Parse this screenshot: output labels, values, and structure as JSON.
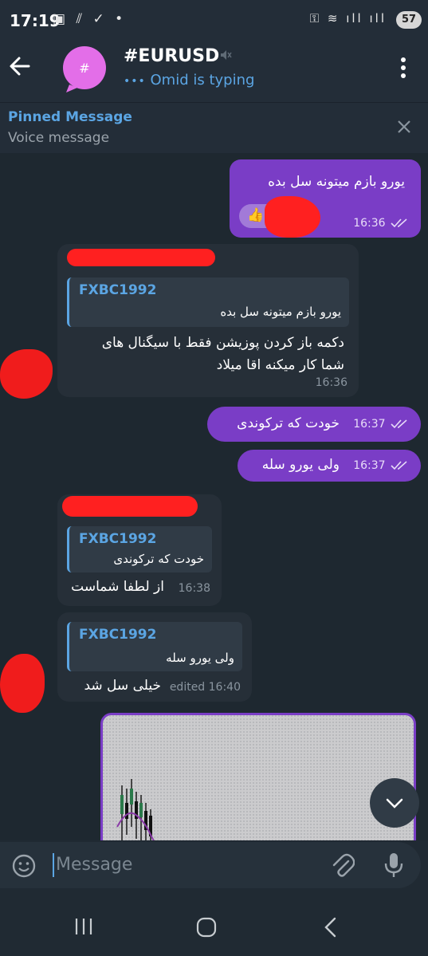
{
  "status_bar": {
    "time": "17:19",
    "left_icons": "▣ ⫽ ✓ •",
    "right_icons": "⚿ ≋ ıll ıll",
    "battery": "57"
  },
  "header": {
    "avatar_symbol": "#",
    "title": "#EURUSD",
    "typing_dots": "•••",
    "typing_text": "Omid is typing"
  },
  "pinned": {
    "title": "Pinned Message",
    "subtitle": "Voice message"
  },
  "messages": [
    {
      "text": "یورو بازم میتونه سل بده",
      "reaction": "👍",
      "time": "16:36"
    },
    {
      "reply_name": "FXBC1992",
      "reply_text": "یورو بازم میتونه سل بده",
      "text_line1": "دکمه باز کردن پوزیشن فقط با سیگنال های",
      "text_line2": "شما کار میکنه اقا میلاد",
      "time": "16:36"
    },
    {
      "text": "خودت که ترکوندی",
      "time": "16:37"
    },
    {
      "text": "ولی یورو سله",
      "time": "16:37"
    },
    {
      "reply_name": "FXBC1992",
      "reply_text": "خودت که ترکوندی",
      "text": "از لطفا شماست",
      "time": "16:38"
    },
    {
      "reply_name": "FXBC1992",
      "reply_text": "ولی یورو سله",
      "text": "خیلی سل شد",
      "time": "edited 16:40"
    }
  ],
  "input": {
    "placeholder": "Message"
  },
  "colors": {
    "accent": "#5ba5e3",
    "outgoing": "#7a3dc6",
    "incoming": "#262f38",
    "background": "#1e2830"
  }
}
